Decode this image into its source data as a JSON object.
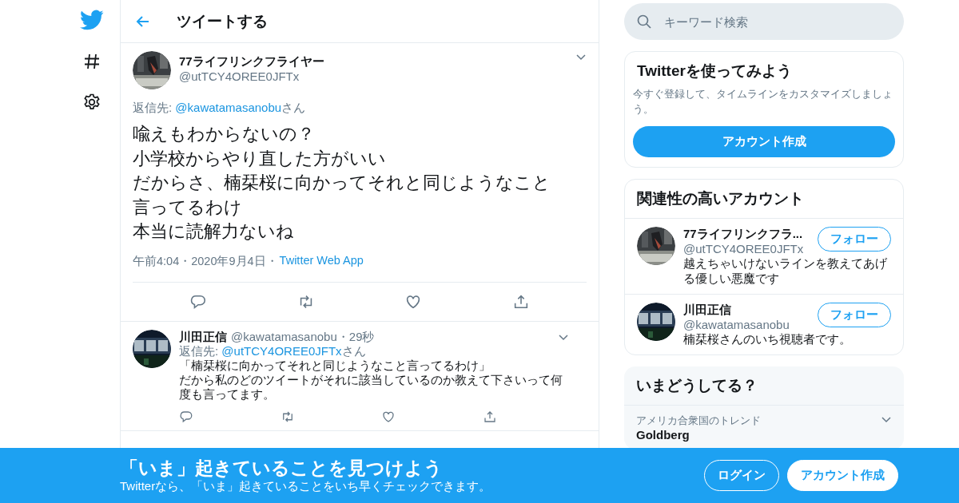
{
  "header": {
    "title": "ツイートする"
  },
  "main_tweet": {
    "name": "77ライフリンクフライヤー",
    "handle": "@utTCY4OREE0JFTx",
    "reply_label": "返信先: ",
    "reply_to": "@kawatamasanobu",
    "reply_suffix": "さん",
    "lines": [
      "喩えもわからないの？",
      "小学校からやり直した方がいい",
      "だからさ、楠栞桜に向かってそれと同じようなこと",
      "言ってるわけ",
      "本当に読解力ないね"
    ],
    "meta": "午前4:04・2020年9月4日・",
    "source": "Twitter Web App"
  },
  "replies": [
    {
      "name": "川田正信",
      "handle": "@kawatamasanobu・29秒",
      "reply_label": "返信先: ",
      "reply_to": "@utTCY4OREE0JFTx",
      "reply_suffix": "さん",
      "lines": [
        "「楠栞桜に向かってそれと同じようなこと言ってるわけ」",
        "だから私のどのツイートがそれに該当しているのか教えて下さいって何度も言ってます。"
      ]
    }
  ],
  "search": {
    "placeholder": "キーワード検索"
  },
  "signup_card": {
    "title": "Twitterを使ってみよう",
    "text": "今すぐ登録して、タイムラインをカスタマイズしましょう。",
    "button": "アカウント作成"
  },
  "related": {
    "title": "関連性の高いアカウント",
    "accounts": [
      {
        "name": "77ライフリンクフラ...",
        "handle": "@utTCY4OREE0JFTx",
        "bio": "越えちゃいけないラインを教えてあげる優しい悪魔です",
        "button": "フォロー"
      },
      {
        "name": "川田正信",
        "handle": "@kawatamasanobu",
        "bio": "楠栞桜さんのいち視聴者です。",
        "button": "フォロー"
      }
    ]
  },
  "trends": {
    "title": "いまどうしてる？",
    "items": [
      {
        "context": "アメリカ合衆国のトレンド",
        "name": "Goldberg"
      }
    ]
  },
  "banner": {
    "title": "「いま」起きていることを見つけよう",
    "subtitle": "Twitterなら、「いま」起きていることをいち早くチェックできます。",
    "buttons": [
      {
        "label": "ログイン",
        "kind": "outline"
      },
      {
        "label": "アカウント作成",
        "kind": "filled"
      }
    ]
  }
}
